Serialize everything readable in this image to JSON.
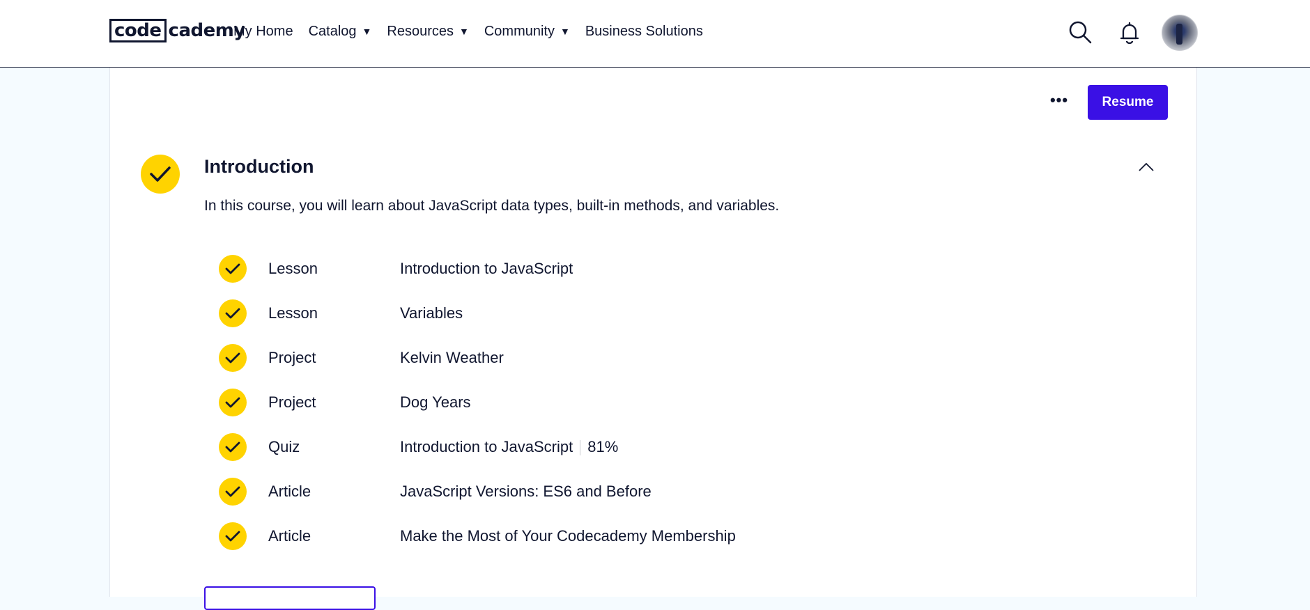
{
  "header": {
    "logo_box": "code",
    "logo_rest": "cademy",
    "nav": [
      {
        "label": "My Home",
        "has_caret": false
      },
      {
        "label": "Catalog",
        "has_caret": true
      },
      {
        "label": "Resources",
        "has_caret": true
      },
      {
        "label": "Community",
        "has_caret": true
      },
      {
        "label": "Business Solutions",
        "has_caret": false
      }
    ],
    "caret": "▼"
  },
  "toolbar": {
    "more_label": "•••",
    "resume_label": "Resume"
  },
  "section": {
    "title": "Introduction",
    "description": "In this course, you will learn about JavaScript data types, built-in methods, and variables.",
    "items": [
      {
        "type": "Lesson",
        "title": "Introduction to JavaScript",
        "score": ""
      },
      {
        "type": "Lesson",
        "title": "Variables",
        "score": ""
      },
      {
        "type": "Project",
        "title": "Kelvin Weather",
        "score": ""
      },
      {
        "type": "Project",
        "title": "Dog Years",
        "score": ""
      },
      {
        "type": "Quiz",
        "title": "Introduction to JavaScript",
        "score": "81%"
      },
      {
        "type": "Article",
        "title": "JavaScript Versions: ES6 and Before",
        "score": ""
      },
      {
        "type": "Article",
        "title": "Make the Most of Your Codecademy Membership",
        "score": ""
      }
    ]
  },
  "colors": {
    "accent": "#3a10e5",
    "check": "#ffd300",
    "text": "#10162f",
    "page_bg": "#f5fbff"
  }
}
